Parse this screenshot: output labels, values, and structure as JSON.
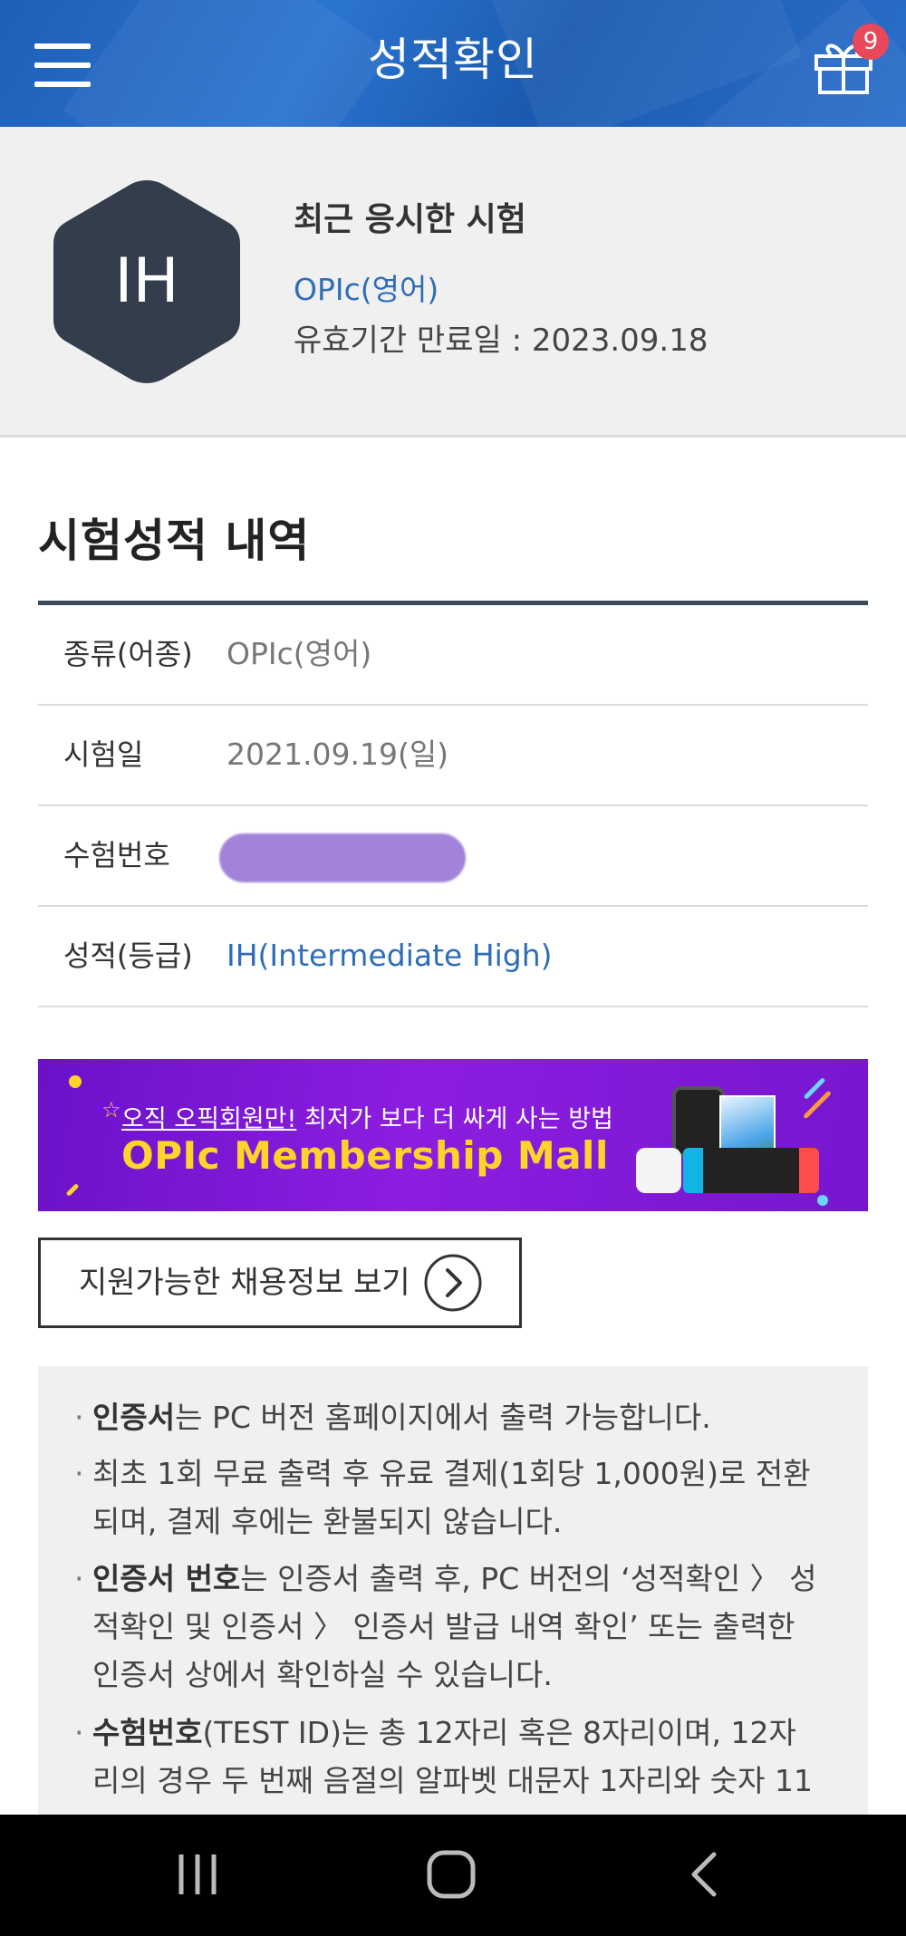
{
  "header": {
    "title": "성적확인",
    "gift_badge_count": "9",
    "menu_icon": "hamburger-menu-icon",
    "gift_icon": "gift-icon"
  },
  "summary": {
    "grade_badge": "IH",
    "recent_label": "최근 응시한 시험",
    "exam_name": "OPIc(영어)",
    "expiry": "유효기간 만료일 : 2023.09.18"
  },
  "section_title": "시험성적 내역",
  "results": {
    "rows": [
      {
        "label": "종류(어종)",
        "value": "OPIc(영어)"
      },
      {
        "label": "시험일",
        "value": "2021.09.19(일)"
      },
      {
        "label": "수험번호",
        "value": ""
      },
      {
        "label": "성적(등급)",
        "value": "IH(Intermediate High)"
      }
    ]
  },
  "banner": {
    "sub_highlight": "오직 오픽회원만!",
    "sub_rest": " 최저가 보다 더 싸게 사는 방법",
    "main": "OPIc Membership Mall"
  },
  "job_button": {
    "label": "지원가능한 채용정보 보기",
    "icon": "chevron-right-circle-icon"
  },
  "notice": {
    "items": [
      {
        "bold": "인증서",
        "text_lines": [
          "는 PC 버전 홈페이지에서 출력 가능합니다."
        ]
      },
      {
        "bold": "",
        "text_lines": [
          "최초 1회 무료 출력 후 유료 결제(1회당 1,000원)로 전환",
          "되며, 결제 후에는 환불되지 않습니다."
        ]
      },
      {
        "bold": "인증서 번호",
        "text_lines": [
          "는 인증서 출력 후, PC 버전의 ‘성적확인 〉 성",
          "적확인 및 인증서 〉 인증서 발급 내역 확인’ 또는 출력한",
          "인증서 상에서 확인하실 수 있습니다."
        ]
      },
      {
        "bold": "수험번호",
        "text_lines": [
          "(TEST ID)는 총 12자리 혹은 8자리이며, 12자",
          "리의 경우 두 번째 음절의 알파벳 대문자 1자리와 숫자 11"
        ]
      }
    ]
  },
  "colors": {
    "header_blue": "#1e5fb8",
    "hex_dark": "#333d4b",
    "link_blue": "#2e6db8",
    "banner_purple": "#7a18d2",
    "banner_yellow": "#ffd42a",
    "badge_red": "#e8485a"
  },
  "navbar": {
    "recent_icon": "recent-apps-icon",
    "home_icon": "home-icon",
    "back_icon": "back-icon"
  }
}
